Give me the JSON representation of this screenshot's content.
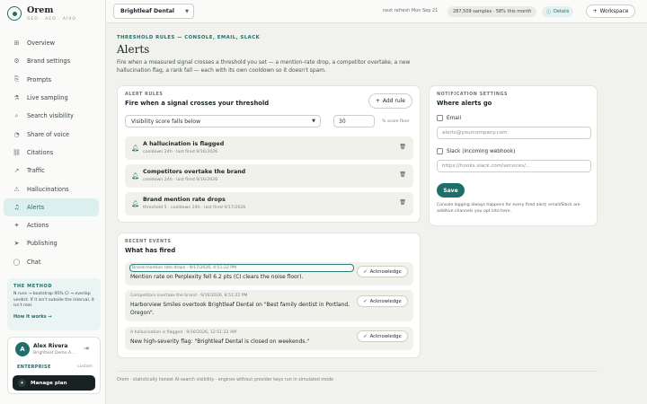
{
  "app": {
    "name": "Orem",
    "tagline": "GEO · AEO · AIVO"
  },
  "sidebar": {
    "items": [
      {
        "label": "Overview",
        "icon": "⊞",
        "name": "overview"
      },
      {
        "label": "Brand settings",
        "icon": "⚙",
        "name": "brand-settings"
      },
      {
        "label": "Prompts",
        "icon": "⎘",
        "name": "prompts"
      },
      {
        "label": "Live sampling",
        "icon": "⚗",
        "name": "live-sampling"
      },
      {
        "label": "Search visibility",
        "icon": "⌕",
        "name": "search-visibility"
      },
      {
        "label": "Share of voice",
        "icon": "◔",
        "name": "share-of-voice"
      },
      {
        "label": "Citations",
        "icon": "⛓",
        "name": "citations"
      },
      {
        "label": "Traffic",
        "icon": "↗",
        "name": "traffic"
      },
      {
        "label": "Hallucinations",
        "icon": "⚠",
        "name": "hallucinations"
      },
      {
        "label": "Alerts",
        "icon": "♫",
        "name": "alerts",
        "active": true
      },
      {
        "label": "Actions",
        "icon": "✦",
        "name": "actions"
      },
      {
        "label": "Publishing",
        "icon": "➤",
        "name": "publishing"
      },
      {
        "label": "Chat",
        "icon": "◯",
        "name": "chat"
      }
    ],
    "method": {
      "title": "THE METHOD",
      "body": "N runs → bootstrap 95% CI → overlap verdict. If it isn't outside the interval, it isn't real.",
      "link": "How it works →"
    },
    "user": {
      "initial": "A",
      "name": "Alex Rivera",
      "org": "Brightleaf Demo A...",
      "tier": "ENTERPRISE",
      "plan_kind": "custom",
      "manage_label": "Manage plan"
    }
  },
  "topbar": {
    "brand_select": "Brightleaf Dental",
    "next_refresh": "next refresh Mon Sep 21",
    "samples": "287,509 samples · 58% this month",
    "details": "Details",
    "workspace": "Workspace"
  },
  "page": {
    "eyebrow": "THRESHOLD RULES — CONSOLE, EMAIL, SLACK",
    "title": "Alerts",
    "description": "Fire when a measured signal crosses a threshold you set — a mention-rate drop, a competitor overtake, a new hallucination flag, a rank fall — each with its own cooldown so it doesn't spam."
  },
  "rules": {
    "eyebrow": "ALERT RULES",
    "title": "Fire when a signal crosses your threshold",
    "add_label": "Add rule",
    "metric": "Visibility score falls below",
    "threshold": "30",
    "unit": "% score floor",
    "items": [
      {
        "name": "A hallucination is flagged",
        "meta": "cooldown 24h · last fired 9/16/2026"
      },
      {
        "name": "Competitors overtake the brand",
        "meta": "cooldown 24h · last fired 9/16/2026"
      },
      {
        "name": "Brand mention rate drops",
        "meta": "threshold 5 · cooldown 24h · last fired 9/17/2026"
      }
    ]
  },
  "notify": {
    "eyebrow": "NOTIFICATION SETTINGS",
    "title": "Where alerts go",
    "email_label": "Email",
    "email_placeholder": "alerts@yourcompany.com",
    "slack_label": "Slack (incoming webhook)",
    "slack_placeholder": "https://hooks.slack.com/services/...",
    "save_label": "Save",
    "note": "Console logging always happens for every fired alert; email/Slack are additive channels you opt into here."
  },
  "events": {
    "eyebrow": "RECENT EVENTS",
    "title": "What has fired",
    "ack_label": "Acknowledge",
    "items": [
      {
        "meta": "Brand mention rate drops · 9/17/2026, 4:51:22 PM",
        "text": "Mention rate on Perplexity fell 6.2 pts (CI clears the noise floor)."
      },
      {
        "meta": "Competitors overtake the brand · 9/16/2026, 8:51:22 PM",
        "text": "Harborview Smiles overtook Brightleaf Dental on \"Best family dentist in Portland, Oregon\"."
      },
      {
        "meta": "A hallucination is flagged · 9/16/2026, 12:51:22 AM",
        "text": "New high-severity flag: \"Brightleaf Dental is closed on weekends.\""
      }
    ]
  },
  "footer": "Orem · statistically honest AI-search visibility · engines without provider keys run in simulated mode"
}
